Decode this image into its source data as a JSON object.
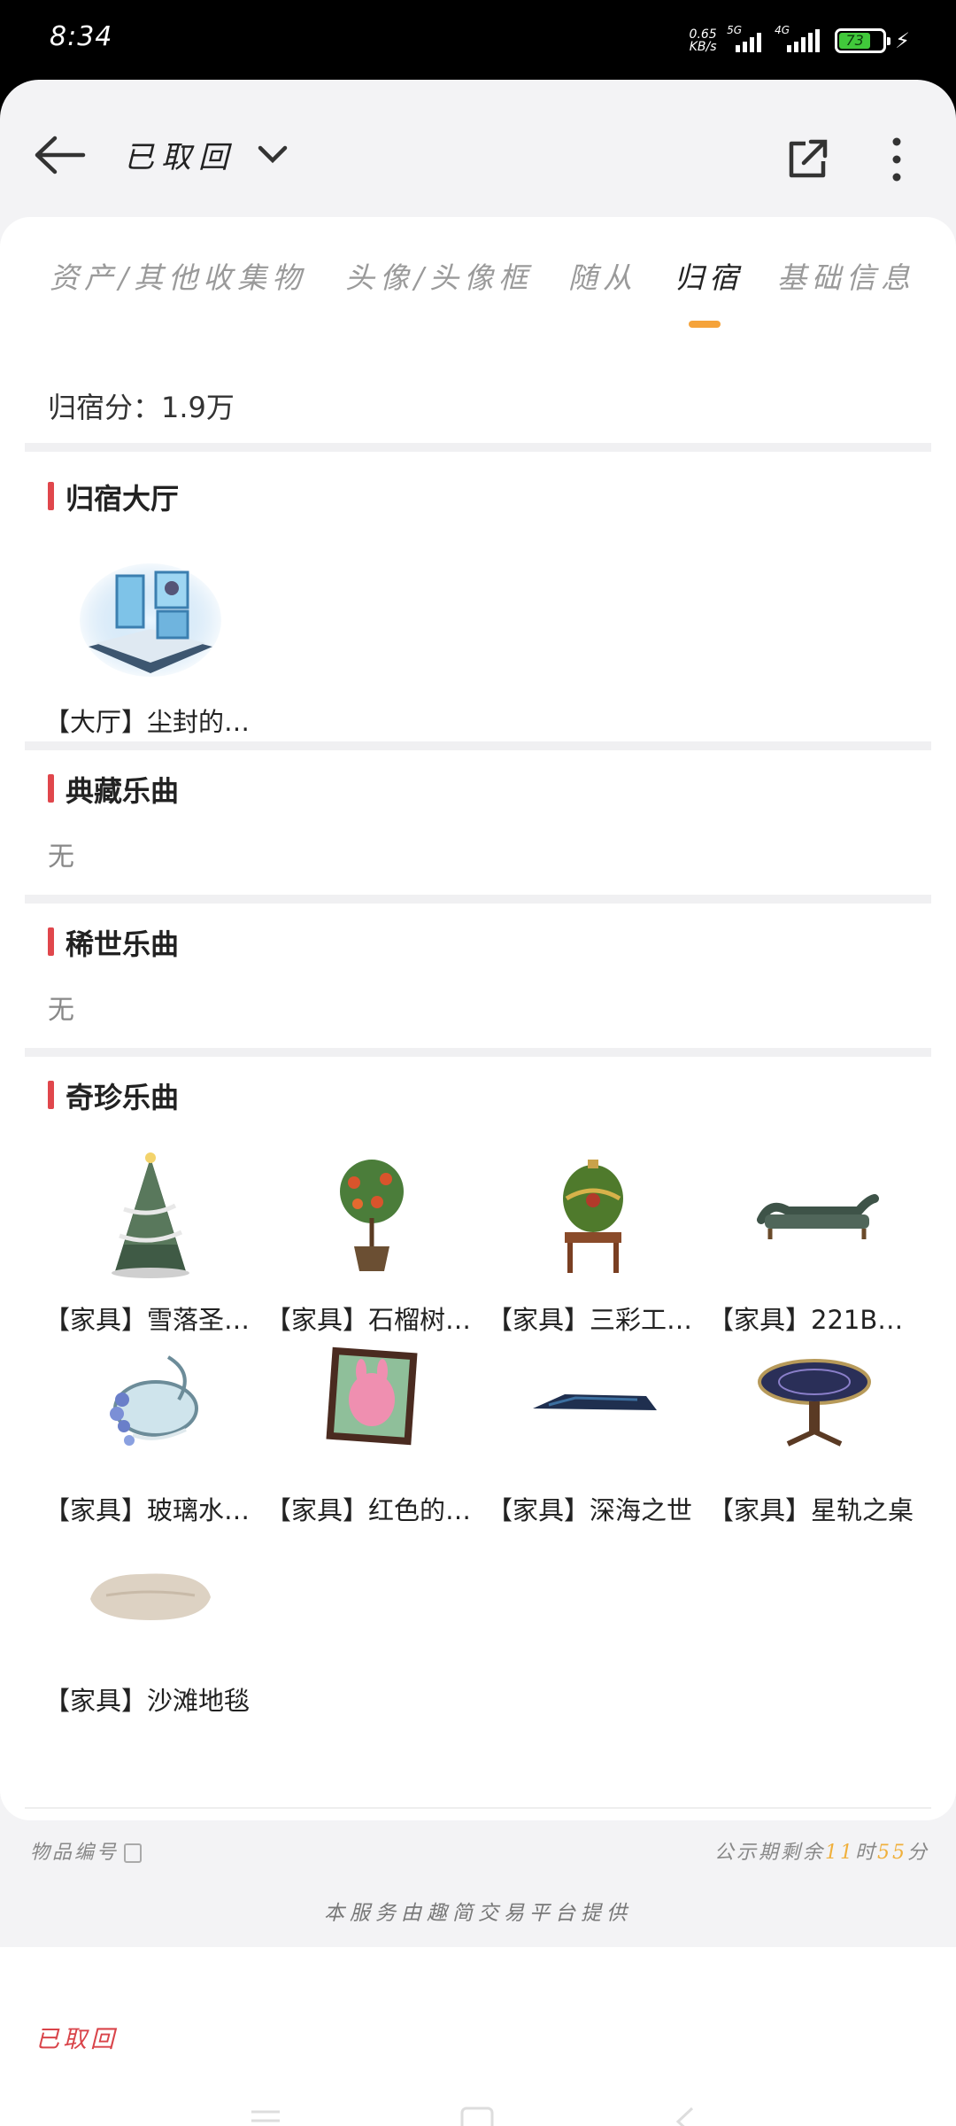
{
  "status_bar": {
    "time": "8:34",
    "net_speed_value": "0.65",
    "net_speed_unit": "KB/s",
    "sim1": "5G",
    "sim2": "4G",
    "battery": "73"
  },
  "header": {
    "title": "已取回",
    "icons": [
      "back-arrow-icon",
      "chevron-down-icon",
      "share-icon",
      "more-vertical-icon"
    ]
  },
  "tabs": [
    {
      "label": "资产/其他收集物"
    },
    {
      "label": "头像/头像框"
    },
    {
      "label": "随从"
    },
    {
      "label": "归宿"
    },
    {
      "label": "基础信息"
    }
  ],
  "active_tab": "归宿",
  "score": "归宿分：1.9万",
  "sections": {
    "hall": {
      "title": "归宿大厅",
      "items": [
        {
          "label": "【大厅】尘封的…"
        }
      ]
    },
    "classic_music": {
      "title": "典藏乐曲",
      "empty": "无"
    },
    "rare_music": {
      "title": "稀世乐曲",
      "empty": "无"
    },
    "treasure_music": {
      "title": "奇珍乐曲",
      "items": [
        {
          "label": "【家具】雪落圣…"
        },
        {
          "label": "【家具】石榴树…"
        },
        {
          "label": "【家具】三彩工…"
        },
        {
          "label": "【家具】221B…"
        },
        {
          "label": "【家具】玻璃水…"
        },
        {
          "label": "【家具】红色的…"
        },
        {
          "label": "【家具】深海之世"
        },
        {
          "label": "【家具】星轨之桌"
        },
        {
          "label": "【家具】沙滩地毯"
        }
      ]
    }
  },
  "footer": {
    "item_id_label": "物品编号",
    "countdown_prefix": "公示期剩余",
    "hours": "11",
    "hours_unit": "时",
    "minutes": "55",
    "minutes_unit": "分"
  },
  "provider": "本服务由趣简交易平台提供",
  "bottom_status": "已取回",
  "colors": {
    "accent_orange": "#f5a33a",
    "section_marker_red": "#e0474c",
    "status_red": "#d9444a"
  }
}
